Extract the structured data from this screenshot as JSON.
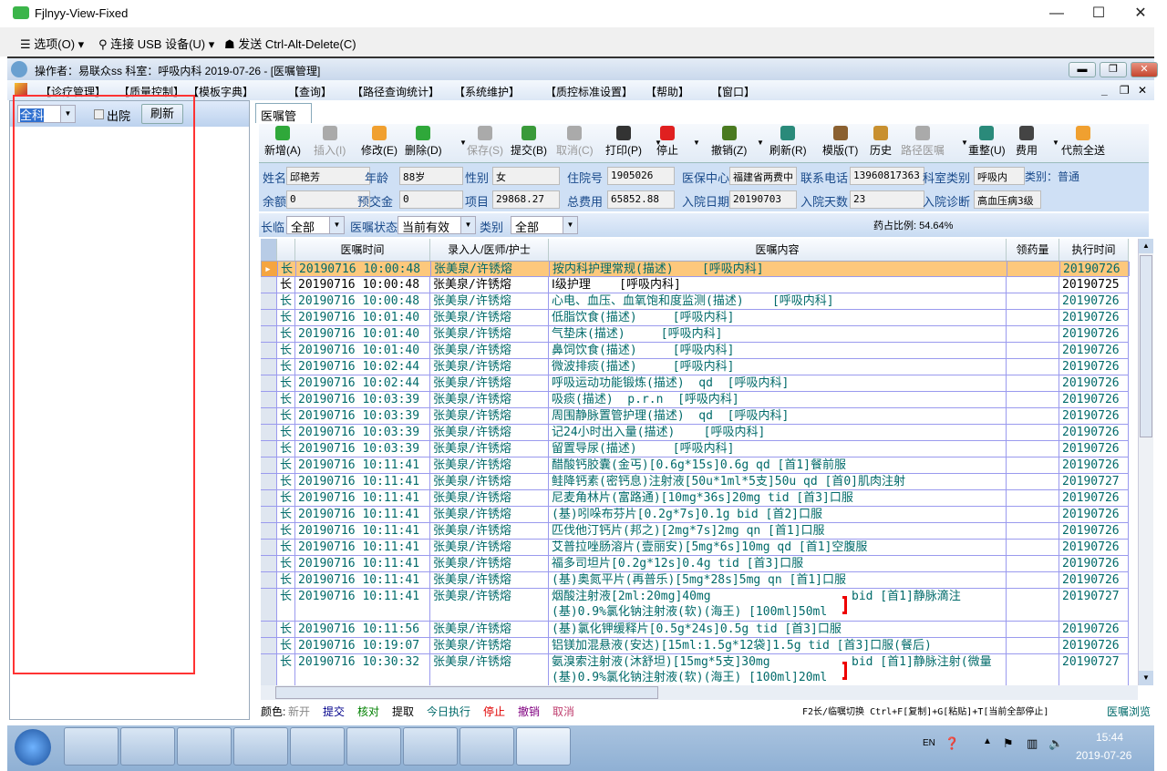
{
  "window": {
    "title": "Fjlnyy-View-Fixed",
    "minimize": "—",
    "maximize": "☐",
    "close": "✕"
  },
  "vm_toolbar": {
    "options": "选项(O) ▾",
    "usb": "连接 USB 设备(U) ▾",
    "cad": "发送 Ctrl-Alt-Delete(C)"
  },
  "app": {
    "title": "操作者：易联众ss  科室：呼吸内科  2019-07-26 - [医嘱管理]"
  },
  "menu": [
    "【诊疗管理】",
    "【质量控制】",
    "【模板字典】",
    "【查询】",
    "【路径查询统计】",
    "【系统维护】",
    "【质控标准设置】",
    "【帮助】",
    "【窗口】"
  ],
  "left": {
    "dept": "全科",
    "discharged_label": "出院",
    "refresh": "刷新"
  },
  "tab": "医嘱管理",
  "toolbar": [
    {
      "label": "新增(A)",
      "icon": "plus-circle-icon",
      "color": "#2fa83a",
      "enabled": true
    },
    {
      "label": "插入(I)",
      "icon": "insert-icon",
      "color": "#aaaaaa",
      "enabled": false
    },
    {
      "label": "修改(E)",
      "icon": "eraser-icon",
      "color": "#f0a030",
      "enabled": true
    },
    {
      "label": "删除(D)",
      "icon": "minus-circle-icon",
      "color": "#2fa83a",
      "enabled": true,
      "dropdown": true
    },
    {
      "label": "保存(S)",
      "icon": "save-icon",
      "color": "#aaaaaa",
      "enabled": false
    },
    {
      "label": "提交(B)",
      "icon": "check-envelope-icon",
      "color": "#3a9a3a",
      "enabled": true
    },
    {
      "label": "取消(C)",
      "icon": "undo-icon",
      "color": "#aaaaaa",
      "enabled": false
    },
    {
      "label": "打印(P)",
      "icon": "printer-icon",
      "color": "#333333",
      "enabled": true,
      "dropdown": true
    },
    {
      "label": "停止",
      "icon": "stop-icon",
      "color": "#e02020",
      "enabled": true,
      "dropdown": true
    },
    {
      "label": "撤销(Z)",
      "icon": "trash-icon",
      "color": "#4a7a20",
      "enabled": true,
      "dropdown": true
    },
    {
      "label": "刷新(R)",
      "icon": "refresh-icon",
      "color": "#2a8a7a",
      "enabled": true
    },
    {
      "label": "模版(T)",
      "icon": "book-icon",
      "color": "#8a6030",
      "enabled": true
    },
    {
      "label": "历史",
      "icon": "history-icon",
      "color": "#c89030",
      "enabled": true
    },
    {
      "label": "路径医嘱",
      "icon": "path-icon",
      "color": "#aaaaaa",
      "enabled": false,
      "dropdown": true
    },
    {
      "label": "重整(U)",
      "icon": "reorganize-icon",
      "color": "#2a8a7a",
      "enabled": true
    },
    {
      "label": "费用",
      "icon": "calculator-icon",
      "color": "#444444",
      "enabled": true,
      "dropdown": true
    },
    {
      "label": "代煎全送",
      "icon": "eraser-icon",
      "color": "#f0a030",
      "enabled": true
    }
  ],
  "patient": {
    "name_l": "姓名",
    "name": "邱艳芳",
    "age_l": "年龄",
    "age": "88岁",
    "sex_l": "性别",
    "sex": "女",
    "inpatient_no_l": "住院号",
    "inpatient_no": "1905026",
    "insurance_l": "医保中心",
    "insurance": "福建省两费中",
    "phone_l": "联系电话",
    "phone": "13960817363",
    "dept_type_l": "科室类别",
    "dept_type": "呼吸内",
    "category": "类别：普通",
    "balance_l": "余额",
    "balance": "0",
    "deposit_l": "预交金",
    "deposit": "0",
    "items_l": "项目",
    "items": "29868.27",
    "total_l": "总费用",
    "total": "65852.88",
    "admit_date_l": "入院日期",
    "admit_date": "20190703",
    "days_l": "入院天数",
    "days": "23",
    "diagnosis_l": "入院诊断",
    "diagnosis": "高血压病3级"
  },
  "filter": {
    "longterm_l": "长临",
    "longterm": "全部",
    "status_l": "医嘱状态",
    "status": "当前有效",
    "type_l": "类别",
    "type": "全部",
    "drug_ratio": "药占比例: 54.64%"
  },
  "grid": {
    "columns": [
      "",
      "",
      "医嘱时间",
      "录入人/医师/护士",
      "医嘱内容",
      "领药量",
      "执行时间"
    ],
    "rows": [
      {
        "kind": "长",
        "time": "20190716 10:00:48",
        "person": "张美泉/许锈熔",
        "content": "按内科护理常规(描述)    [呼吸内科]",
        "exec": "20190726",
        "selected": true
      },
      {
        "kind": "长",
        "time": "20190716 10:00:48",
        "person": "张美泉/许锈熔",
        "content": "Ⅰ级护理    [呼吸内科]",
        "exec": "20190725",
        "black": true
      },
      {
        "kind": "长",
        "time": "20190716 10:00:48",
        "person": "张美泉/许锈熔",
        "content": "心电、血压、血氧饱和度监测(描述)    [呼吸内科]",
        "exec": "20190726"
      },
      {
        "kind": "长",
        "time": "20190716 10:01:40",
        "person": "张美泉/许锈熔",
        "content": "低脂饮食(描述)     [呼吸内科]",
        "exec": "20190726"
      },
      {
        "kind": "长",
        "time": "20190716 10:01:40",
        "person": "张美泉/许锈熔",
        "content": "气垫床(描述)     [呼吸内科]",
        "exec": "20190726"
      },
      {
        "kind": "长",
        "time": "20190716 10:01:40",
        "person": "张美泉/许锈熔",
        "content": "鼻饲饮食(描述)     [呼吸内科]",
        "exec": "20190726"
      },
      {
        "kind": "长",
        "time": "20190716 10:02:44",
        "person": "张美泉/许锈熔",
        "content": "微波排痰(描述)     [呼吸内科]",
        "exec": "20190726"
      },
      {
        "kind": "长",
        "time": "20190716 10:02:44",
        "person": "张美泉/许锈熔",
        "content": "呼吸运动功能锻炼(描述)  qd  [呼吸内科]",
        "exec": "20190726"
      },
      {
        "kind": "长",
        "time": "20190716 10:03:39",
        "person": "张美泉/许锈熔",
        "content": "吸痰(描述)  p.r.n  [呼吸内科]",
        "exec": "20190726"
      },
      {
        "kind": "长",
        "time": "20190716 10:03:39",
        "person": "张美泉/许锈熔",
        "content": "周围静脉置管护理(描述)  qd  [呼吸内科]",
        "exec": "20190726"
      },
      {
        "kind": "长",
        "time": "20190716 10:03:39",
        "person": "张美泉/许锈熔",
        "content": "记24小时出入量(描述)    [呼吸内科]",
        "exec": "20190726"
      },
      {
        "kind": "长",
        "time": "20190716 10:03:39",
        "person": "张美泉/许锈熔",
        "content": "留置导尿(描述)     [呼吸内科]",
        "exec": "20190726"
      },
      {
        "kind": "长",
        "time": "20190716 10:11:41",
        "person": "张美泉/许锈熔",
        "content": "醋酸钙胶囊(金丐)[0.6g*15s]0.6g qd [首1]餐前服",
        "exec": "20190726"
      },
      {
        "kind": "长",
        "time": "20190716 10:11:41",
        "person": "张美泉/许锈熔",
        "content": "鲑降钙素(密钙息)注射液[50u*1ml*5支]50u qd [首0]肌肉注射",
        "exec": "20190727"
      },
      {
        "kind": "长",
        "time": "20190716 10:11:41",
        "person": "张美泉/许锈熔",
        "content": "尼麦角林片(富路通)[10mg*36s]20mg tid [首3]口服",
        "exec": "20190726"
      },
      {
        "kind": "长",
        "time": "20190716 10:11:41",
        "person": "张美泉/许锈熔",
        "content": "(基)吲哚布芬片[0.2g*7s]0.1g bid [首2]口服",
        "exec": "20190726"
      },
      {
        "kind": "长",
        "time": "20190716 10:11:41",
        "person": "张美泉/许锈熔",
        "content": "匹伐他汀钙片(邦之)[2mg*7s]2mg qn [首1]口服",
        "exec": "20190726"
      },
      {
        "kind": "长",
        "time": "20190716 10:11:41",
        "person": "张美泉/许锈熔",
        "content": "艾普拉唑肠溶片(壹丽安)[5mg*6s]10mg qd [首1]空腹服",
        "exec": "20190726"
      },
      {
        "kind": "长",
        "time": "20190716 10:11:41",
        "person": "张美泉/许锈熔",
        "content": "福多司坦片[0.2g*12s]0.4g tid [首3]口服",
        "exec": "20190726"
      },
      {
        "kind": "长",
        "time": "20190716 10:11:41",
        "person": "张美泉/许锈熔",
        "content": "(基)奥氮平片(再普乐)[5mg*28s]5mg qn [首1]口服",
        "exec": "20190726"
      },
      {
        "kind": "长",
        "time": "20190716 10:11:41",
        "person": "张美泉/许锈熔",
        "content": "烟酸注射液[2ml:20mg]40mg",
        "content2": "(基)0.9%氯化钠注射液(软)(海王) [100ml]50ml",
        "group": "bid [首1]静脉滴注",
        "exec": "20190727"
      },
      {
        "kind": "长",
        "time": "20190716 10:11:56",
        "person": "张美泉/许锈熔",
        "content": "(基)氯化钾缓释片[0.5g*24s]0.5g tid [首3]口服",
        "exec": "20190726"
      },
      {
        "kind": "长",
        "time": "20190716 10:19:07",
        "person": "张美泉/许锈熔",
        "content": "铝镁加混悬液(安达)[15ml:1.5g*12袋]1.5g tid [首3]口服(餐后)",
        "exec": "20190726"
      },
      {
        "kind": "长",
        "time": "20190716 10:30:32",
        "person": "张美泉/许锈熔",
        "content": "氨溴索注射液(沐舒坦)[15mg*5支]30mg",
        "content2": "(基)0.9%氯化钠注射液(软)(海王) [100ml]20ml",
        "group": "bid [首1]静脉注射(微量",
        "exec": "20190727"
      }
    ]
  },
  "legend": {
    "label": "颜色:",
    "items": [
      {
        "t": "新开",
        "c": "#888888"
      },
      {
        "t": "提交",
        "c": "#00008b"
      },
      {
        "t": "核对",
        "c": "#008000"
      },
      {
        "t": "提取",
        "c": "#000000"
      },
      {
        "t": "今日执行",
        "c": "#006a6a"
      },
      {
        "t": "停止",
        "c": "#e00000"
      },
      {
        "t": "撤销",
        "c": "#800080"
      },
      {
        "t": "取消",
        "c": "#c04070"
      }
    ],
    "shortcuts": "F2长/临嘱切换 Ctrl+F[复制]+G[粘贴]+T[当前全部停止]",
    "browse": "医嘱浏览"
  },
  "taskbar": {
    "lang": "EN",
    "time": "15:44",
    "date": "2019-07-26"
  }
}
